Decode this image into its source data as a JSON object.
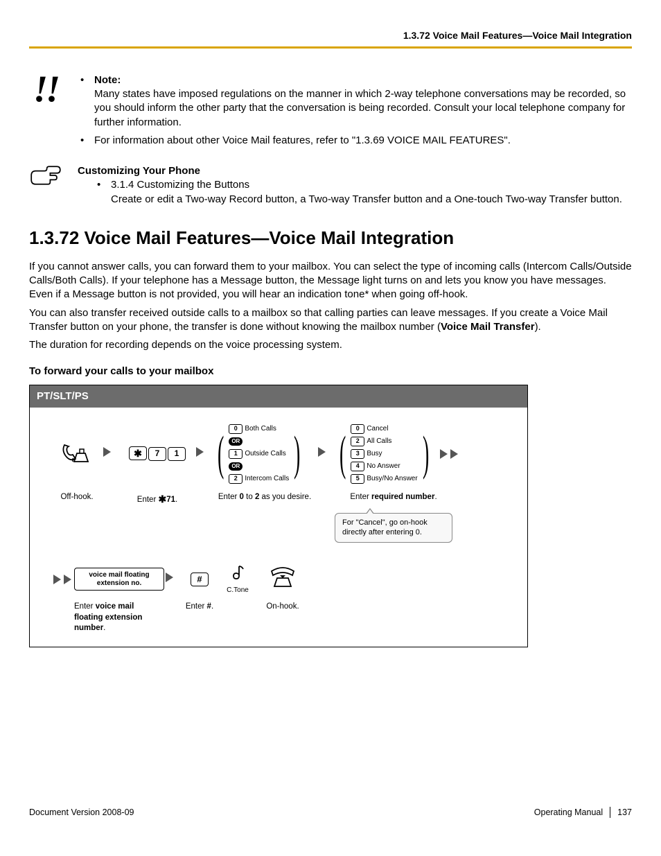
{
  "header": {
    "title": "1.3.72 Voice Mail Features—Voice Mail Integration"
  },
  "noteBlock": {
    "noteLabel": "Note:",
    "noteBody": "Many states have imposed regulations on the manner in which 2-way telephone conversations may be recorded, so you should inform the other party that the conversation is being recorded. Consult your local telephone company for further information.",
    "bullet2": "For information about other Voice Mail features, refer to \"1.3.69  VOICE MAIL FEATURES\"."
  },
  "customBlock": {
    "heading": "Customizing Your Phone",
    "item1line1": "3.1.4  Customizing the Buttons",
    "item1line2": "Create or edit a Two-way Record button, a Two-way Transfer button and a One-touch Two-way Transfer button."
  },
  "section": {
    "title": "1.3.72  Voice Mail Features—Voice Mail Integration",
    "para1": "If you cannot answer calls, you can forward them to your mailbox. You can select the type of incoming calls (Intercom Calls/Outside Calls/Both Calls). If your telephone has a Message button, the Message light turns on and lets you know you have messages. Even if a Message button is not provided, you will hear an indication tone* when going off-hook.",
    "para2a": "You can also transfer received outside calls to a mailbox so that calling parties can leave messages. If you create a Voice Mail Transfer button on your phone, the transfer is done without knowing the mailbox number (",
    "para2bold": "Voice Mail Transfer",
    "para2b": ").",
    "para3": "The duration for recording depends on the voice processing system.",
    "subhead": "To forward your calls to your mailbox"
  },
  "diagram": {
    "header": "PT/SLT/PS",
    "keys": {
      "star": "✱",
      "seven": "7",
      "one": "1",
      "pound": "#"
    },
    "choice1": {
      "k0": "0",
      "l0": "Both Calls",
      "or": "OR",
      "k1": "1",
      "l1": "Outside Calls",
      "k2": "2",
      "l2": "Intercom Calls"
    },
    "choice2": {
      "k0": "0",
      "l0": "Cancel",
      "k2": "2",
      "l2": "All Calls",
      "k3": "3",
      "l3": "Busy",
      "k4": "4",
      "l4": "No Answer",
      "k5": "5",
      "l5": "Busy/No Answer"
    },
    "captions": {
      "offhook": "Off-hook.",
      "enter71a": "Enter ",
      "enter71b": "71",
      "enter71c": ".",
      "enter02a": "Enter ",
      "enter02b": "0",
      "enter02c": " to ",
      "enter02d": "2",
      "enter02e": " as you desire.",
      "enterReqA": "Enter ",
      "enterReqB": "required number",
      "enterReqC": ".",
      "bubble": "For \"Cancel\", go on-hook directly after entering 0.",
      "extBox1": "voice mail floating",
      "extBox2": "extension no.",
      "ctone": "C.Tone",
      "onhook": "On-hook.",
      "enterExtA": "Enter ",
      "enterExtB": "voice mail floating extension number",
      "enterExtC": ".",
      "enterPoundA": "Enter ",
      "enterPoundB": "#",
      "enterPoundC": "."
    }
  },
  "footer": {
    "left": "Document Version  2008-09",
    "rightLabel": "Operating Manual",
    "pageNum": "137"
  }
}
